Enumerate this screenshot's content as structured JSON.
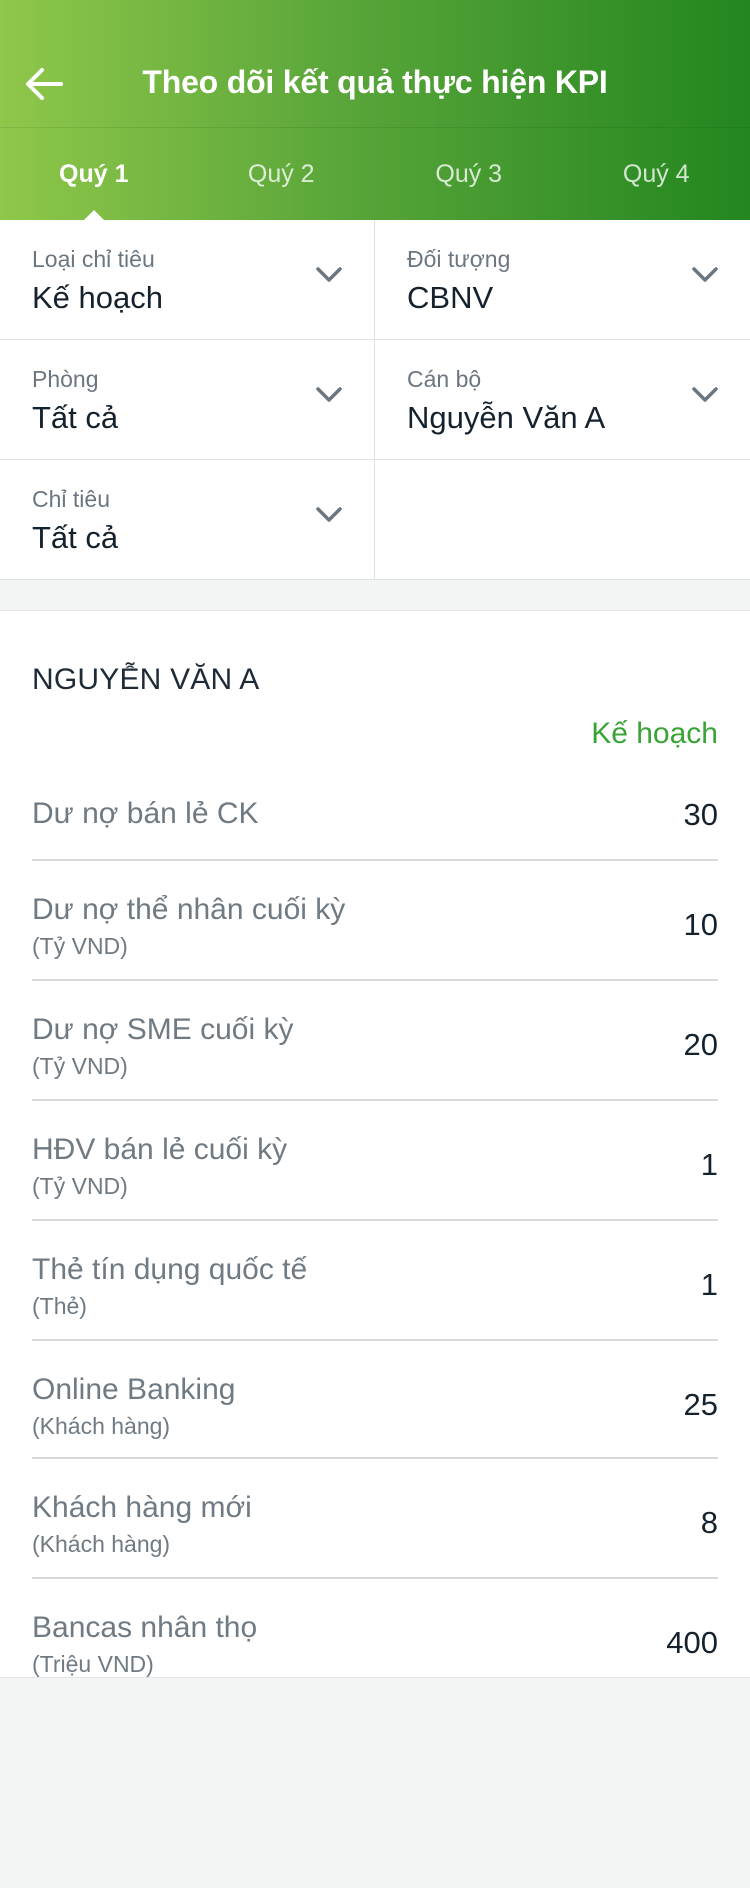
{
  "header": {
    "title": "Theo dõi kết quả thực hiện KPI",
    "back_icon": "arrow-left-icon",
    "gradient": [
      "#8fc74a",
      "#23861f"
    ]
  },
  "tabs": [
    {
      "label": "Quý 1",
      "active": true
    },
    {
      "label": "Quý 2",
      "active": false
    },
    {
      "label": "Quý 3",
      "active": false
    },
    {
      "label": "Quý 4",
      "active": false
    }
  ],
  "filters": {
    "loai_chi_tieu": {
      "label": "Loại chỉ tiêu",
      "value": "Kế hoạch"
    },
    "doi_tuong": {
      "label": "Đối tượng",
      "value": "CBNV"
    },
    "phong": {
      "label": "Phòng",
      "value": "Tất cả"
    },
    "can_bo": {
      "label": "Cán bộ",
      "value": "Nguyễn Văn A"
    },
    "chi_tieu": {
      "label": "Chỉ tiêu",
      "value": "Tất cả"
    },
    "chevron_icon": "chevron-down-icon"
  },
  "results": {
    "person_name": "NGUYỄN VĂN A",
    "column_header": "Kế hoạch",
    "accent_color": "#3aa335",
    "rows": [
      {
        "name": "Dư nợ bán lẻ CK",
        "unit": "",
        "value": "30"
      },
      {
        "name": "Dư nợ thể nhân cuối kỳ",
        "unit": "(Tỷ VND)",
        "value": "10"
      },
      {
        "name": "Dư nợ SME cuối kỳ",
        "unit": "(Tỷ VND)",
        "value": "20"
      },
      {
        "name": "HĐV bán lẻ cuối kỳ",
        "unit": "(Tỷ VND)",
        "value": "1"
      },
      {
        "name": "Thẻ tín dụng quốc tế",
        "unit": "(Thẻ)",
        "value": "1"
      },
      {
        "name": "Online Banking",
        "unit": "(Khách hàng)",
        "value": "25"
      },
      {
        "name": "Khách hàng mới",
        "unit": "(Khách hàng)",
        "value": "8"
      },
      {
        "name": "Bancas nhân thọ",
        "unit": "(Triệu VND)",
        "value": "400"
      }
    ]
  }
}
